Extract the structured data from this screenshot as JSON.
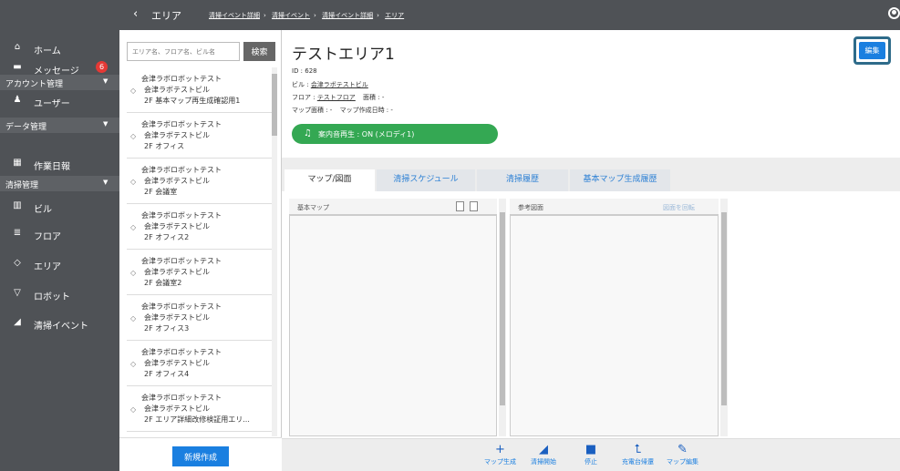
{
  "topbar": {
    "back_icon": "chevron-left-icon",
    "title": "エリア",
    "breadcrumbs": [
      "清掃イベント詳細",
      "清掃イベント",
      "清掃イベント詳細",
      "エリア"
    ],
    "user_icon": "user-circle-icon"
  },
  "sidebar": {
    "home": "ホーム",
    "messages": "メッセージ",
    "messages_badge": "6",
    "sec_account": "アカウント管理",
    "users": "ユーザー",
    "sec_data": "データ管理",
    "daily_report": "作業日報",
    "sec_cleaning": "清掃管理",
    "building": "ビル",
    "floor": "フロア",
    "area": "エリア",
    "robot": "ロボット",
    "cleaning_event": "清掃イベント"
  },
  "search": {
    "placeholder": "エリア名、フロア名、ビル名",
    "button": "検索"
  },
  "area_list": [
    {
      "company": "会津ラボロボットテスト",
      "building": "会津ラボテストビル",
      "room": "2F 基本マップ再生成確認用1"
    },
    {
      "company": "会津ラボロボットテスト",
      "building": "会津ラボテストビル",
      "room": "2F オフィス"
    },
    {
      "company": "会津ラボロボットテスト",
      "building": "会津ラボテストビル",
      "room": "2F 会議室"
    },
    {
      "company": "会津ラボロボットテスト",
      "building": "会津ラボテストビル",
      "room": "2F オフィス2"
    },
    {
      "company": "会津ラボロボットテスト",
      "building": "会津ラボテストビル",
      "room": "2F 会議室2"
    },
    {
      "company": "会津ラボロボットテスト",
      "building": "会津ラボテストビル",
      "room": "2F オフィス3"
    },
    {
      "company": "会津ラボロボットテスト",
      "building": "会津ラボテストビル",
      "room": "2F オフィス4"
    },
    {
      "company": "会津ラボロボットテスト",
      "building": "会津ラボテストビル",
      "room": "2F エリア詳細改修検証用エリ..."
    }
  ],
  "create_button": "新規作成",
  "detail": {
    "title": "テストエリア1",
    "id_line": "ID : 628",
    "building_label": "ビル : ",
    "building_value": "会津ラボテストビル",
    "floor_label": "フロア : ",
    "floor_value": "テストフロア",
    "area_size": "面積 : -",
    "map_size": "マップ面積 : -",
    "map_created": "マップ作成日時 : -",
    "music": "案内音再生 : ON (メロディ1)",
    "edit_button": "編集"
  },
  "tabs": [
    "マップ/図面",
    "清掃スケジュール",
    "清掃履歴",
    "基本マップ生成履歴"
  ],
  "panels": {
    "base_map": "基本マップ",
    "reference": "参考図面",
    "rotate": "図面を回転"
  },
  "toolbar": [
    {
      "icon": "plus-icon",
      "label": "マップ生成"
    },
    {
      "icon": "broom-icon",
      "label": "清掃開始"
    },
    {
      "icon": "stop-icon",
      "label": "停止"
    },
    {
      "icon": "return-icon",
      "label": "充電台帰還"
    },
    {
      "icon": "edit-icon",
      "label": "マップ編集"
    }
  ]
}
